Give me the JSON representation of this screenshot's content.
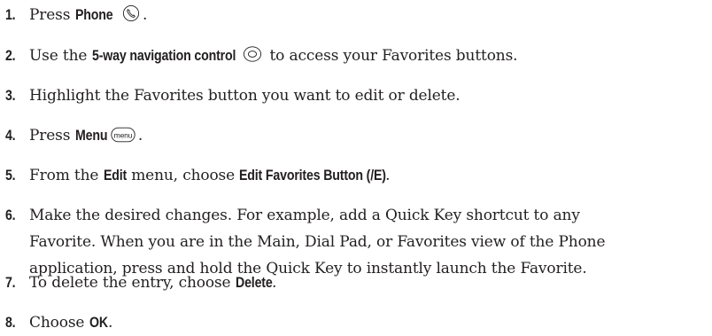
{
  "steps": [
    {
      "num": "1.",
      "parts": {
        "a": "Press ",
        "bold1": "Phone",
        "b": ".",
        "icon": "phone-key-icon"
      }
    },
    {
      "num": "2.",
      "parts": {
        "a": "Use the ",
        "bold1": "5-way navigation control",
        "b": " to access your Favorites buttons.",
        "icon": "5-way-navigation-icon"
      }
    },
    {
      "num": "3.",
      "parts": {
        "a": "Highlight the Favorites button you want to edit or delete."
      }
    },
    {
      "num": "4.",
      "parts": {
        "a": "Press ",
        "bold1": "Menu",
        "b": ".",
        "icon": "menu-key-icon",
        "icon_label": "menu"
      }
    },
    {
      "num": "5.",
      "parts": {
        "a": "From the ",
        "bold1": "Edit",
        "b": " menu, choose ",
        "bold2": "Edit Favorites Button (/E)",
        "c": "."
      }
    },
    {
      "num": "6.",
      "line1": "Make the desired changes. For example, add a Quick Key shortcut to any",
      "line2": "Favorite. When you are in the Main, Dial Pad, or Favorites view of the Phone",
      "line3": "application, press and hold the Quick Key to instantly launch the Favorite."
    },
    {
      "num": "7.",
      "parts": {
        "a": "To delete the entry, choose ",
        "bold1": "Delete",
        "b": "."
      }
    },
    {
      "num": "8.",
      "parts": {
        "a": "Choose ",
        "bold1": "OK",
        "b": "."
      }
    }
  ]
}
